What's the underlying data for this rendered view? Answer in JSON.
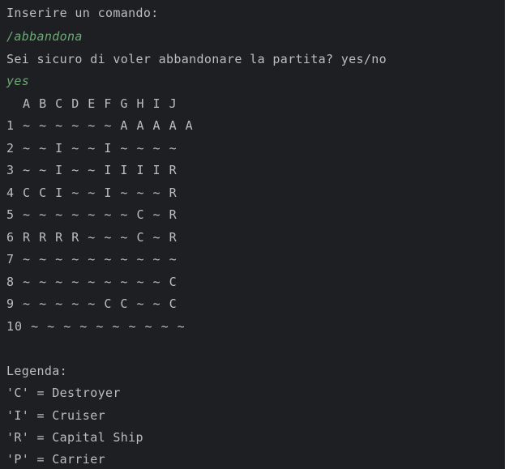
{
  "console": {
    "prompt": "Inserire un comando:",
    "command": "/abbandona",
    "question": "Sei sicuro di voler abbandonare la partita? yes/no",
    "answer": "yes",
    "grid": {
      "header": "  A B C D E F G H I J",
      "rows": [
        "1 ~ ~ ~ ~ ~ ~ A A A A A",
        "2 ~ ~ I ~ ~ I ~ ~ ~ ~",
        "3 ~ ~ I ~ ~ I I I I R",
        "4 C C I ~ ~ I ~ ~ ~ R",
        "5 ~ ~ ~ ~ ~ ~ ~ C ~ R",
        "6 R R R R ~ ~ ~ C ~ R",
        "7 ~ ~ ~ ~ ~ ~ ~ ~ ~ ~",
        "8 ~ ~ ~ ~ ~ ~ ~ ~ ~ C",
        "9 ~ ~ ~ ~ ~ C C ~ ~ C",
        "10 ~ ~ ~ ~ ~ ~ ~ ~ ~ ~"
      ]
    },
    "legend": {
      "title": "Legenda:",
      "items": [
        "'C' = Destroyer",
        "'I' = Cruiser",
        "'R' = Capital Ship",
        "'P' = Carrier"
      ]
    }
  }
}
